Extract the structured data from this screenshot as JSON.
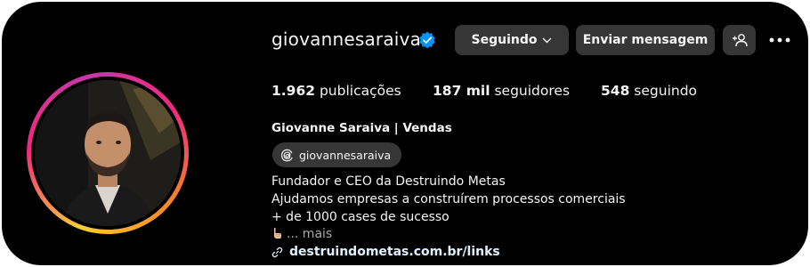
{
  "profile": {
    "username": "giovannesaraiva",
    "verified_color": "#0095f6",
    "full_name": "Giovanne Saraiva | Vendas",
    "threads_handle": "giovannesaraiva"
  },
  "actions": {
    "following_label": "Seguindo",
    "message_label": "Enviar mensagem"
  },
  "stats": {
    "posts_count": "1.962",
    "posts_label": "publicações",
    "followers_count": "187 mil",
    "followers_label": "seguidores",
    "following_count": "548",
    "following_label": "seguindo"
  },
  "bio": {
    "line1": "Fundador e CEO da Destruindo Metas",
    "line2": "Ajudamos empresas a construírem processos comerciais",
    "line3": "+ de 1000 cases de sucesso",
    "more_label": "... mais"
  },
  "link": {
    "url_text": "destruindometas.com.br/links"
  },
  "icons": [
    "verified-badge-icon",
    "chevron-down-icon",
    "add-person-icon",
    "more-options-icon",
    "threads-icon",
    "pointing-hand-icon",
    "link-icon"
  ]
}
